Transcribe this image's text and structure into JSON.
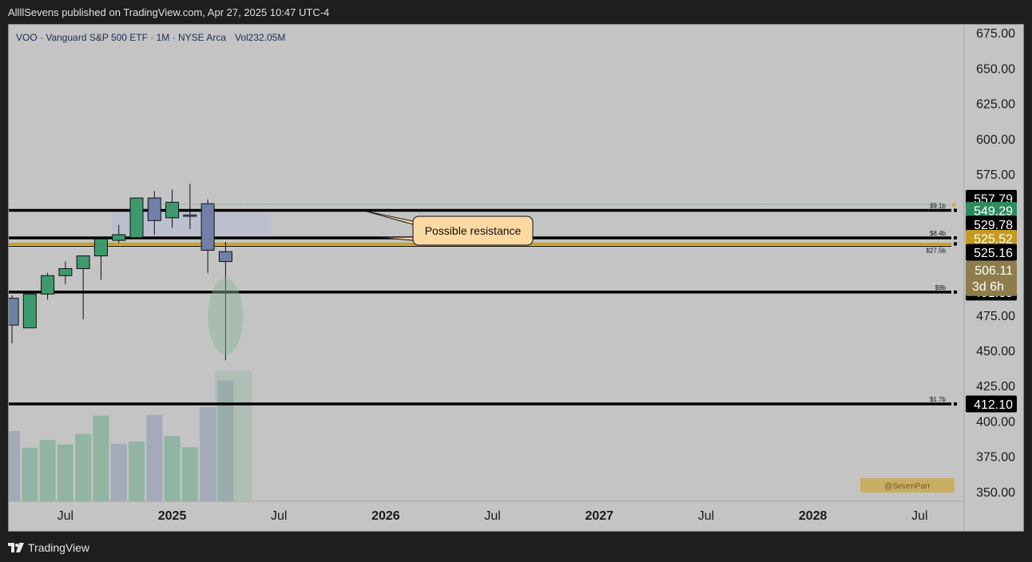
{
  "header": {
    "published": "AllllSevens published on TradingView.com, Apr 27, 2025 10:47 UTC-4"
  },
  "footer": {
    "brand": "TradingView",
    "logo_icon": "tradingview-logo-icon"
  },
  "symbol_info": {
    "text": "VOO · Vanguard S&P 500 ETF · 1M · NYSE Arca",
    "vol_text": "Vol232.05M"
  },
  "colors": {
    "plot_bg": "#c4c4c4",
    "up": "#3e9a6e",
    "down": "#7080a8",
    "level_line": "#000000",
    "gold_line": "#c8a020",
    "zone": "#b9bed0",
    "callout_bg": "#fbd9a3",
    "vol_circle": "#88b597"
  },
  "annotations": {
    "callout": "Possible resistance",
    "watermark": "@SevenParr",
    "dotted_marker": "d"
  },
  "chart_data": {
    "type": "candlestick",
    "interval": "1M",
    "y_ticks": [
      350,
      375,
      400,
      425,
      450,
      475,
      500,
      525,
      550,
      575,
      600,
      625,
      650,
      675
    ],
    "y_tick_labels": [
      "350.00",
      "375.00",
      "400.00",
      "425.00",
      "450.00",
      "475.00",
      "500.00",
      "525.00",
      "550.00",
      "575.00",
      "600.00",
      "625.00",
      "650.00",
      "675.00"
    ],
    "x_labels": [
      {
        "t": 6,
        "label": "Jul"
      },
      {
        "t": 12,
        "label": "2025"
      },
      {
        "t": 18,
        "label": "Jul"
      },
      {
        "t": 24,
        "label": "2026"
      },
      {
        "t": 30,
        "label": "Jul"
      },
      {
        "t": 36,
        "label": "2027"
      },
      {
        "t": 42,
        "label": "Jul"
      },
      {
        "t": 48,
        "label": "2028"
      },
      {
        "t": 54,
        "label": "Jul"
      }
    ],
    "candles": [
      {
        "t": 3,
        "o": 487,
        "h": 489,
        "l": 455,
        "c": 468
      },
      {
        "t": 4,
        "o": 466,
        "h": 490,
        "l": 466,
        "c": 490
      },
      {
        "t": 5,
        "o": 490,
        "h": 505,
        "l": 486,
        "c": 503
      },
      {
        "t": 6,
        "o": 503,
        "h": 513,
        "l": 497,
        "c": 508
      },
      {
        "t": 7,
        "o": 508,
        "h": 517,
        "l": 472,
        "c": 517
      },
      {
        "t": 8,
        "o": 517,
        "h": 530,
        "l": 500,
        "c": 529
      },
      {
        "t": 9,
        "o": 528,
        "h": 539,
        "l": 526,
        "c": 532
      },
      {
        "t": 10,
        "o": 530,
        "h": 553,
        "l": 529,
        "c": 558
      },
      {
        "t": 11,
        "o": 558,
        "h": 563,
        "l": 532,
        "c": 542
      },
      {
        "t": 12,
        "o": 544,
        "h": 564,
        "l": 537,
        "c": 555
      },
      {
        "t": 13,
        "o": 546,
        "h": 568,
        "l": 536,
        "c": 545
      },
      {
        "t": 14,
        "o": 554,
        "h": 557,
        "l": 505,
        "c": 521
      },
      {
        "t": 15,
        "o": 520,
        "h": 527,
        "l": 443,
        "c": 513
      }
    ],
    "volume": [
      {
        "t": 3,
        "v": 1.0,
        "dir": "down"
      },
      {
        "t": 4,
        "v": 0.76,
        "dir": "up"
      },
      {
        "t": 5,
        "v": 0.87,
        "dir": "up"
      },
      {
        "t": 6,
        "v": 0.81,
        "dir": "up"
      },
      {
        "t": 7,
        "v": 0.96,
        "dir": "up"
      },
      {
        "t": 8,
        "v": 1.22,
        "dir": "up"
      },
      {
        "t": 9,
        "v": 0.82,
        "dir": "down"
      },
      {
        "t": 10,
        "v": 0.85,
        "dir": "up"
      },
      {
        "t": 11,
        "v": 1.23,
        "dir": "down"
      },
      {
        "t": 12,
        "v": 0.93,
        "dir": "up"
      },
      {
        "t": 13,
        "v": 0.77,
        "dir": "up"
      },
      {
        "t": 14,
        "v": 1.34,
        "dir": "down"
      },
      {
        "t": 15,
        "v": 1.72,
        "dir": "down"
      }
    ],
    "levels": [
      {
        "price": 549.29,
        "label": "$9.1b"
      },
      {
        "price": 529.78,
        "label": "$8.4b"
      },
      {
        "price": 525.52,
        "label": "$27.5b",
        "gold": true
      },
      {
        "price": 491.35,
        "label": "$9b"
      },
      {
        "price": 412.1,
        "label": "$1.7b"
      }
    ],
    "zone": {
      "t_from": 8.6,
      "t_to": 17.5,
      "from": 529.78,
      "to": 549.29
    },
    "badges": [
      {
        "price": 557.79,
        "text": "557.79",
        "bg": "#000000",
        "fg": "#ffffff"
      },
      {
        "price": 549.29,
        "text": "549.29",
        "bg": "#2f8a5e",
        "fg": "#ffffff"
      },
      {
        "price": 539.5,
        "text": "529.78",
        "bg": "#000000",
        "fg": "#ffffff"
      },
      {
        "price": 529.5,
        "text": "525.52",
        "bg": "#c59a1e",
        "fg": "#ffffff"
      },
      {
        "price": 519.5,
        "text": "525.16",
        "bg": "#000000",
        "fg": "#ffffff"
      },
      {
        "price": 491.35,
        "text": "491.35",
        "bg": "#000000",
        "fg": "#ffffff"
      },
      {
        "price": 412.1,
        "text": "412.10",
        "bg": "#000000",
        "fg": "#ffffff"
      }
    ],
    "current": {
      "price": 506.11,
      "text": "506.11",
      "countdown": "3d 6h",
      "bg": "#8e7d4a",
      "fg": "#ffffff"
    }
  }
}
